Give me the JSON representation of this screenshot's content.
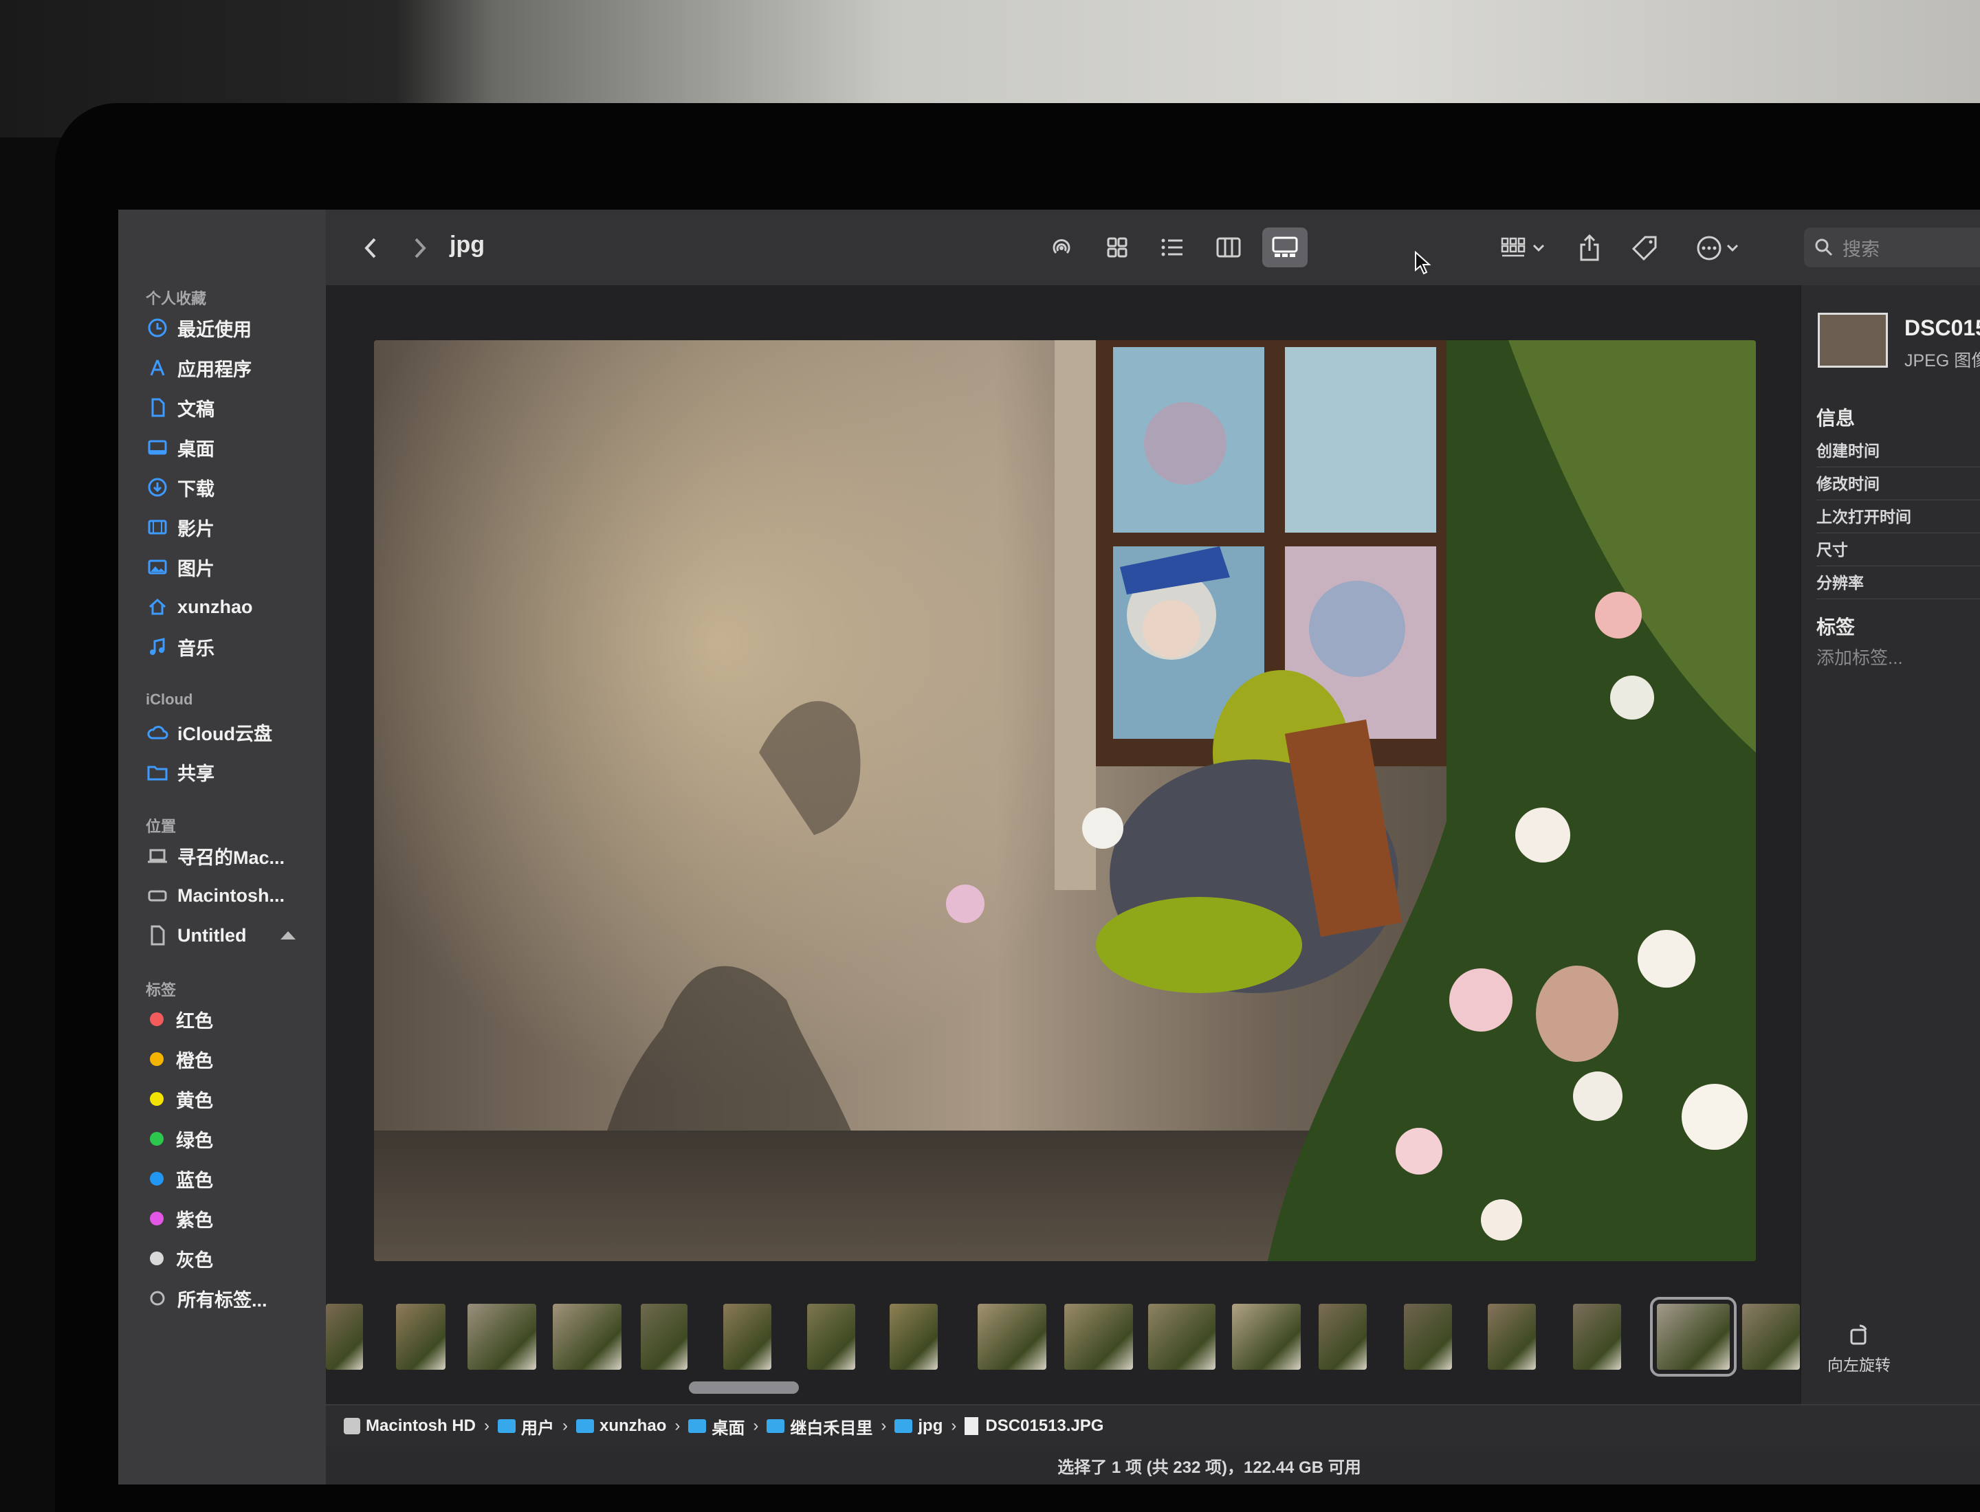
{
  "window": {
    "title": "jpg",
    "search_placeholder": "搜索"
  },
  "sidebar": {
    "favorites_title": "个人收藏",
    "favorites": [
      {
        "label": "最近使用",
        "icon": "clock-icon"
      },
      {
        "label": "应用程序",
        "icon": "apps-icon"
      },
      {
        "label": "文稿",
        "icon": "document-icon"
      },
      {
        "label": "桌面",
        "icon": "desktop-icon"
      },
      {
        "label": "下载",
        "icon": "download-icon"
      },
      {
        "label": "影片",
        "icon": "film-icon"
      },
      {
        "label": "图片",
        "icon": "photo-icon"
      },
      {
        "label": "xunzhao",
        "icon": "home-icon"
      },
      {
        "label": "音乐",
        "icon": "music-icon"
      }
    ],
    "icloud_title": "iCloud",
    "icloud": [
      {
        "label": "iCloud云盘",
        "icon": "cloud-icon"
      },
      {
        "label": "共享",
        "icon": "shared-folder-icon"
      }
    ],
    "locations_title": "位置",
    "locations": [
      {
        "label": "寻召的Mac...",
        "icon": "laptop-icon"
      },
      {
        "label": "Macintosh...",
        "icon": "disk-icon"
      },
      {
        "label": "Untitled",
        "icon": "file-icon"
      }
    ],
    "tags_title": "标签",
    "tags": [
      {
        "label": "红色",
        "color": "#f45b5b"
      },
      {
        "label": "橙色",
        "color": "#f5b400"
      },
      {
        "label": "黄色",
        "color": "#f2e300"
      },
      {
        "label": "绿色",
        "color": "#2cc84d"
      },
      {
        "label": "蓝色",
        "color": "#2196f3"
      },
      {
        "label": "紫色",
        "color": "#e257e6"
      },
      {
        "label": "灰色",
        "color": "#d9d9d9"
      }
    ],
    "all_tags_label": "所有标签..."
  },
  "inspector": {
    "file_name": "DSC015",
    "file_kind": "JPEG 图像",
    "info_title": "信息",
    "info_rows": [
      "创建时间",
      "修改时间",
      "上次打开时间",
      "尺寸",
      "分辨率"
    ],
    "tags_title": "标签",
    "add_tag_placeholder": "添加标签...",
    "rotate_label": "向左旋转"
  },
  "pathbar": {
    "items": [
      "Macintosh HD",
      "用户",
      "xunzhao",
      "桌面",
      "继白禾目里",
      "jpg",
      "DSC01513.JPG"
    ]
  },
  "statusbar": {
    "text": "选择了 1 项 (共 232 项)，122.44 GB 可用"
  },
  "filmstrip": {
    "selected_index": 16
  }
}
